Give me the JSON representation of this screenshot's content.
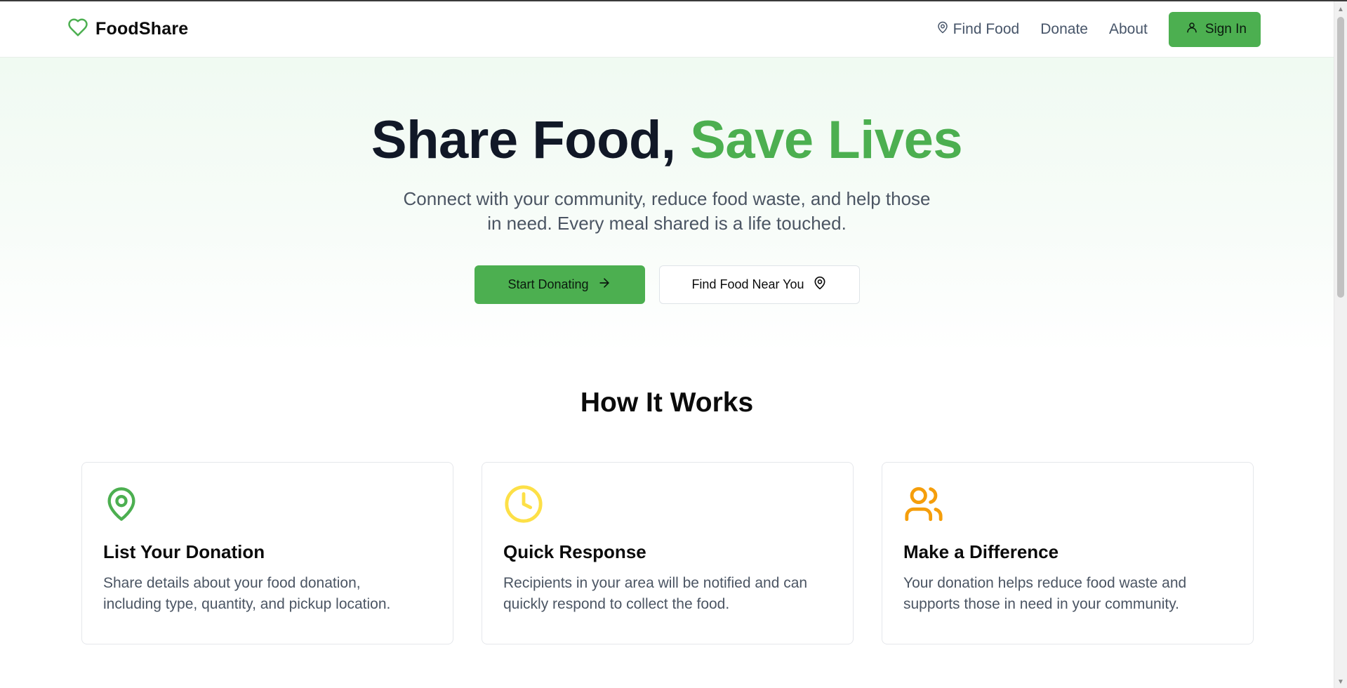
{
  "header": {
    "brand": "FoodShare",
    "nav": {
      "find_food": "Find Food",
      "donate": "Donate",
      "about": "About"
    },
    "sign_in": "Sign In"
  },
  "hero": {
    "title_main": "Share Food,",
    "title_accent": "Save Lives",
    "subtitle_line1": "Connect with your community, reduce food waste, and help those",
    "subtitle_line2": "in need. Every meal shared is a life touched.",
    "primary_button": "Start Donating",
    "secondary_button": "Find Food Near You"
  },
  "how_it_works": {
    "title": "How It Works",
    "cards": [
      {
        "icon": "map-pin-icon",
        "icon_color": "#4caf50",
        "title": "List Your Donation",
        "text_line1": "Share details about your food donation,",
        "text_line2": "including type, quantity, and pickup location."
      },
      {
        "icon": "clock-icon",
        "icon_color": "#fde047",
        "title": "Quick Response",
        "text_line1": "Recipients in your area will be notified and can",
        "text_line2": "quickly respond to collect the food."
      },
      {
        "icon": "users-icon",
        "icon_color": "#f59e0b",
        "title": "Make a Difference",
        "text_line1": "Your donation helps reduce food waste and",
        "text_line2": "supports those in need in your community."
      }
    ]
  },
  "colors": {
    "brand_green": "#4caf50",
    "heading_dark": "#111827",
    "body_text": "#4b5563"
  }
}
